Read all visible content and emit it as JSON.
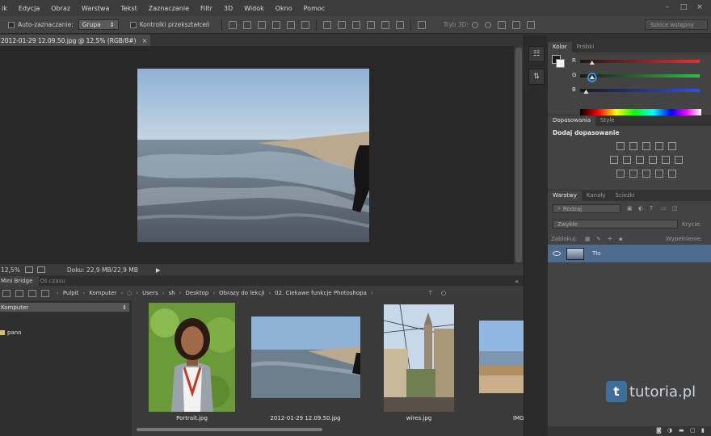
{
  "menu": [
    "ik",
    "Edycja",
    "Obraz",
    "Warstwa",
    "Tekst",
    "Zaznaczanie",
    "Filtr",
    "3D",
    "Widok",
    "Okno",
    "Pomoc"
  ],
  "options_bar": {
    "auto_select_label": "Auto-zaznaczanie:",
    "auto_select_value": "Grupa",
    "transform_label": "Kontrolki przekształceń",
    "mode3d_label": "Tryb 3D:",
    "workspace": "Szkice wstępny"
  },
  "document": {
    "tab_title": "2012-01-29 12.09.50.jpg @ 12,5% (RGB/8#)",
    "close": "×",
    "zoom": "12,5%",
    "doc_info": "Doku: 22,9 MB/22,9 MB"
  },
  "mini_bridge": {
    "tabs": [
      "Mini Bridge",
      "Oś czasu"
    ],
    "breadcrumbs": [
      "Pulpit",
      "Komputer",
      "Users",
      "sh",
      "Desktop",
      "Obrazy do lekcji",
      "02. Ciekawe funkcje Photoshopa"
    ],
    "location": "Komputer",
    "folder": "pano",
    "thumbnails": [
      {
        "label": "Portrait.jpg"
      },
      {
        "label": "2012-01-29 12.09.50.jpg"
      },
      {
        "label": "wires.jpg"
      },
      {
        "label": "IMG"
      }
    ]
  },
  "color_panel": {
    "tabs": [
      "Kolor",
      "Próbki"
    ],
    "channels": [
      {
        "label": "R",
        "value": 0.1
      },
      {
        "label": "G",
        "value": 0.1
      },
      {
        "label": "B",
        "value": 0.05
      }
    ],
    "colors": {
      "r": "#e53030",
      "g": "#30c040",
      "b": "#3050e0"
    }
  },
  "adjustments_panel": {
    "tabs": [
      "Dopasowania",
      "Style"
    ],
    "title": "Dodaj dopasowanie"
  },
  "layers_panel": {
    "tabs": [
      "Warstwy",
      "Kanały",
      "Ścieżki"
    ],
    "filter": "Rodzaj",
    "blend_mode": "Zwykłe",
    "opacity_label": "Krycie:",
    "lock_label": "Zablokuj:",
    "fill_label": "Wypełnienie:",
    "layer_name": "Tło"
  },
  "watermark": {
    "logo": "t",
    "text": "tutoria.pl"
  }
}
